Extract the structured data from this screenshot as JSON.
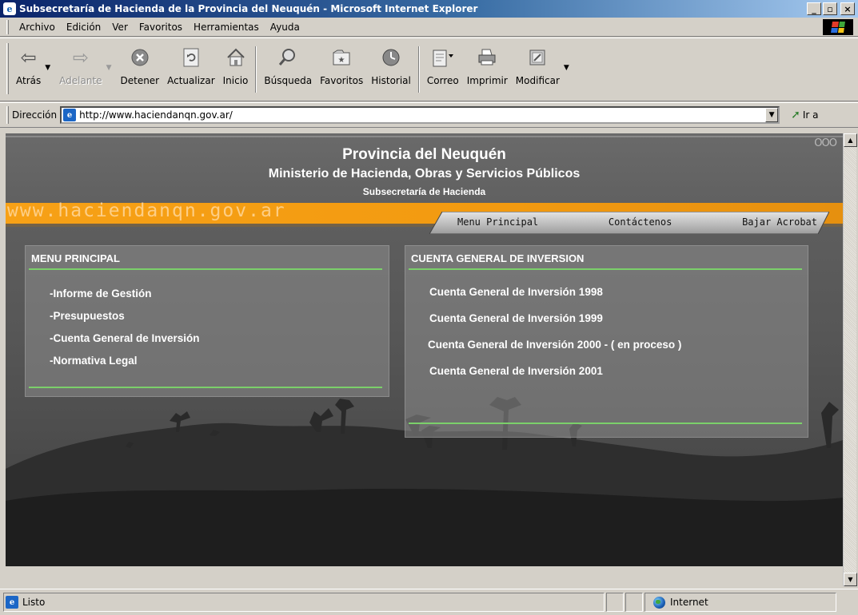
{
  "window": {
    "title": "Subsecretaría de Hacienda de la Provincia del Neuquén - Microsoft Internet Explorer",
    "controls": {
      "minimize": "_",
      "maximize": "▫",
      "close": "×"
    }
  },
  "menubar": {
    "items": [
      "Archivo",
      "Edición",
      "Ver",
      "Favoritos",
      "Herramientas",
      "Ayuda"
    ]
  },
  "toolbar": {
    "buttons": [
      {
        "label": "Atrás",
        "icon": "back-arrow-icon",
        "enabled": true,
        "dropdown": true
      },
      {
        "label": "Adelante",
        "icon": "forward-arrow-icon",
        "enabled": false,
        "dropdown": true
      },
      {
        "label": "Detener",
        "icon": "stop-icon",
        "enabled": true
      },
      {
        "label": "Actualizar",
        "icon": "refresh-icon",
        "enabled": true
      },
      {
        "label": "Inicio",
        "icon": "home-icon",
        "enabled": true
      },
      {
        "label": "Búsqueda",
        "icon": "search-icon",
        "enabled": true
      },
      {
        "label": "Favoritos",
        "icon": "favorites-icon",
        "enabled": true
      },
      {
        "label": "Historial",
        "icon": "history-icon",
        "enabled": true
      },
      {
        "label": "Correo",
        "icon": "mail-icon",
        "enabled": true,
        "dropdown": true
      },
      {
        "label": "Imprimir",
        "icon": "print-icon",
        "enabled": true
      },
      {
        "label": "Modificar",
        "icon": "edit-icon",
        "enabled": true,
        "dropdown": true
      }
    ]
  },
  "address": {
    "label": "Dirección",
    "url": "http://www.haciendanqn.gov.ar/",
    "go_label": "Ir a"
  },
  "page": {
    "header": {
      "line1": "Provincia del Neuquén",
      "line2": "Ministerio de Hacienda, Obras y Servicios Públicos",
      "line3": "Subsecretaría de Hacienda"
    },
    "site_url": "www.haciendanqn.gov.ar",
    "corner_dots": "OOO",
    "nav": [
      "Menu Principal",
      "Contáctenos",
      "Bajar Acrobat"
    ],
    "menu_panel": {
      "title": "MENU PRINCIPAL",
      "items": [
        "-Informe de Gestión",
        "-Presupuestos",
        "-Cuenta General de Inversión",
        "-Normativa Legal"
      ]
    },
    "cgi_panel": {
      "title": "CUENTA  GENERAL DE INVERSION",
      "items": [
        "Cuenta General de Inversión 1998",
        "Cuenta General de Inversión 1999",
        "Cuenta General de Inversión 2000 - ( en proceso )",
        "Cuenta General de Inversión 2001"
      ]
    },
    "colors": {
      "accent_orange": "#f29a10",
      "rule_green": "#7bd06a",
      "panel_text": "#ffffff"
    }
  },
  "status": {
    "text": "Listo",
    "zone": "Internet"
  }
}
